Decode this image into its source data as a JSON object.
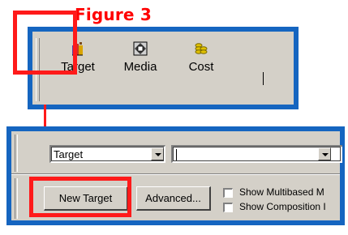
{
  "figure_title": "Figure 3",
  "toolbar": {
    "buttons": [
      {
        "label": "Target",
        "icon": "target-books-icon"
      },
      {
        "label": "Media",
        "icon": "media-icon"
      },
      {
        "label": "Cost",
        "icon": "coins-icon"
      }
    ]
  },
  "target_bar": {
    "type_select_value": "Target",
    "target_combo_value": "",
    "new_target_label": "New Target",
    "advanced_label": "Advanced...",
    "checkbox_multibased_label": "Show Multibased M",
    "checkbox_composition_label": "Show Composition I"
  },
  "colors": {
    "highlight": "#ff1a1a",
    "frame": "#1565c0",
    "window_bg": "#d4d0c8"
  }
}
